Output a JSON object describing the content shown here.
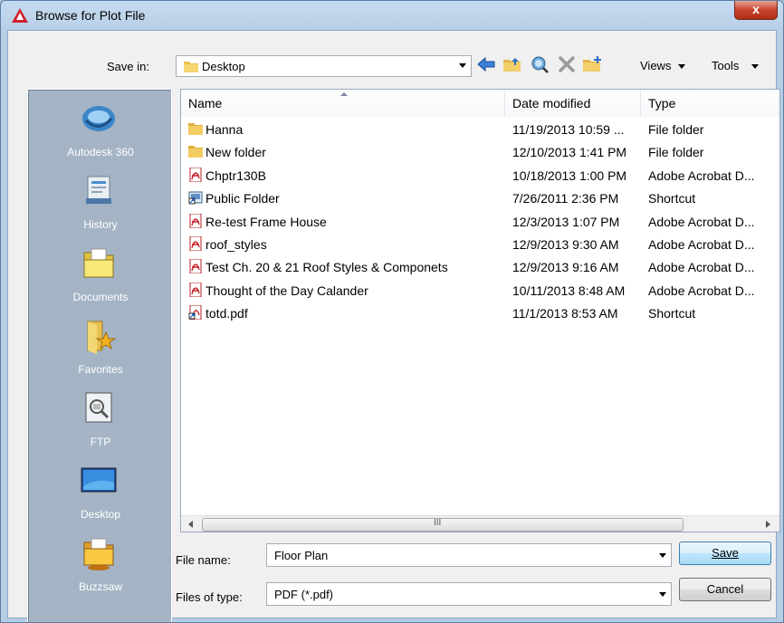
{
  "window": {
    "title": "Browse for Plot File",
    "close_label": "x"
  },
  "toolbar": {
    "save_in_label": "Save in:",
    "save_in_value": "Desktop",
    "views_label": "Views",
    "tools_label": "Tools"
  },
  "places": [
    {
      "label": "Autodesk 360",
      "icon": "autodesk-360-icon"
    },
    {
      "label": "History",
      "icon": "history-icon"
    },
    {
      "label": "Documents",
      "icon": "documents-folder-icon"
    },
    {
      "label": "Favorites",
      "icon": "favorites-folder-icon"
    },
    {
      "label": "FTP",
      "icon": "ftp-icon"
    },
    {
      "label": "Desktop",
      "icon": "desktop-icon"
    },
    {
      "label": "Buzzsaw",
      "icon": "buzzsaw-icon"
    }
  ],
  "columns": {
    "name": "Name",
    "date": "Date modified",
    "type": "Type"
  },
  "files": [
    {
      "name": "Hanna",
      "date": "11/19/2013 10:59 ...",
      "type": "File folder",
      "icon": "folder-icon"
    },
    {
      "name": "New folder",
      "date": "12/10/2013 1:41 PM",
      "type": "File folder",
      "icon": "folder-icon"
    },
    {
      "name": "Chptr130B",
      "date": "10/18/2013 1:00 PM",
      "type": "Adobe Acrobat D...",
      "icon": "pdf-icon"
    },
    {
      "name": "Public Folder",
      "date": "7/26/2011 2:36 PM",
      "type": "Shortcut",
      "icon": "shortcut-icon"
    },
    {
      "name": "Re-test Frame House",
      "date": "12/3/2013 1:07 PM",
      "type": "Adobe Acrobat D...",
      "icon": "pdf-icon"
    },
    {
      "name": "roof_styles",
      "date": "12/9/2013 9:30 AM",
      "type": "Adobe Acrobat D...",
      "icon": "pdf-icon"
    },
    {
      "name": "Test Ch. 20 & 21 Roof Styles & Componets",
      "date": "12/9/2013 9:16 AM",
      "type": "Adobe Acrobat D...",
      "icon": "pdf-icon"
    },
    {
      "name": "Thought of the Day Calander",
      "date": "10/11/2013 8:48 AM",
      "type": "Adobe Acrobat D...",
      "icon": "pdf-icon"
    },
    {
      "name": "totd.pdf",
      "date": "11/1/2013 8:53 AM",
      "type": "Shortcut",
      "icon": "pdf-shortcut-icon"
    }
  ],
  "scrollbar": {
    "grip": "III"
  },
  "footer": {
    "file_name_label": "File name:",
    "file_name_value": "Floor Plan",
    "file_type_label": "Files of type:",
    "file_type_value": "PDF (*.pdf)",
    "save_button": "Save",
    "cancel_button": "Cancel"
  }
}
